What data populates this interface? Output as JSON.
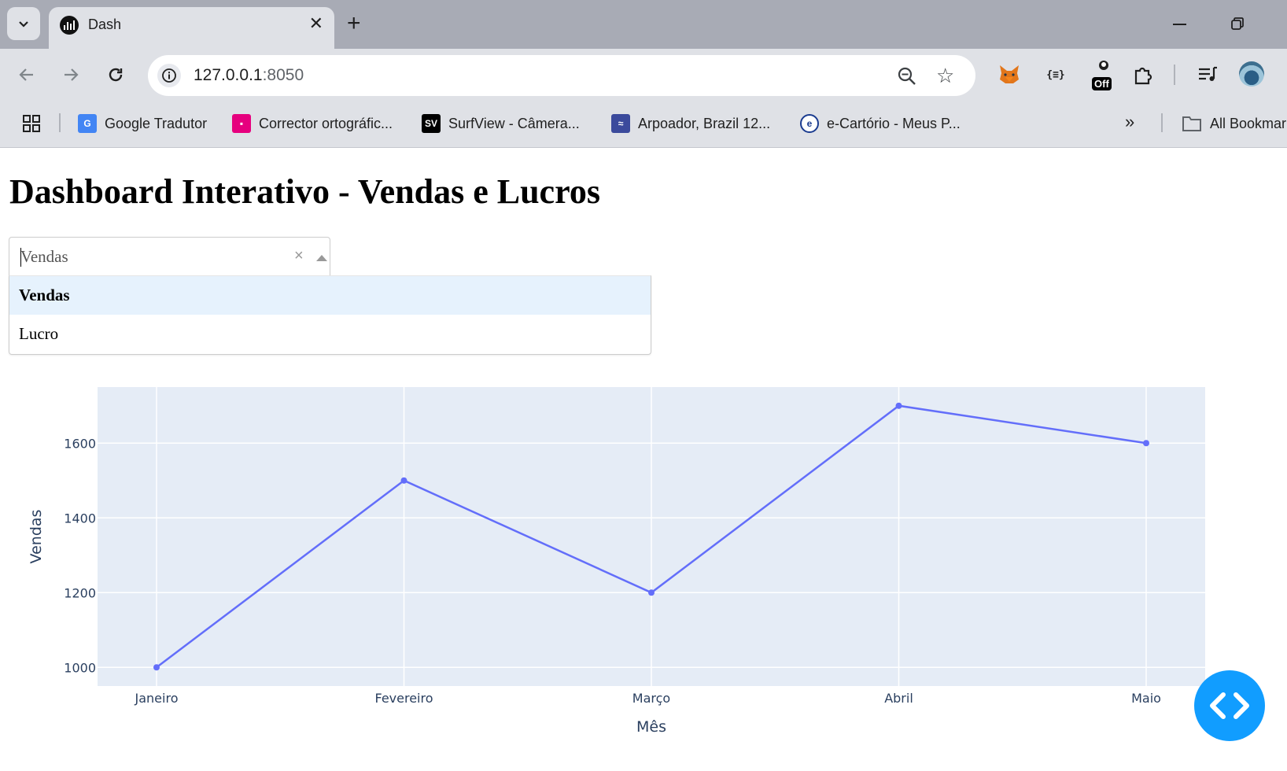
{
  "browser": {
    "tab_title": "Dash",
    "url_host": "127.0.0.1",
    "url_port": ":8050",
    "extensions": [
      "metamask-fox",
      "{≡}",
      "Off",
      "puzzle-piece"
    ],
    "bookmarks": [
      {
        "label": "Google Tradutor",
        "icon": "google-translate-icon"
      },
      {
        "label": "Corrector ortográfic...",
        "icon": "corrector-icon"
      },
      {
        "label": "SurfView - Câmera...",
        "icon": "surfview-icon"
      },
      {
        "label": "Arpoador, Brazil 12...",
        "icon": "arpoador-icon"
      },
      {
        "label": "e-Cartório - Meus P...",
        "icon": "ecartorio-icon"
      }
    ],
    "all_bookmarks": "All Bookmarks"
  },
  "page": {
    "title": "Dashboard Interativo - Vendas e Lucros"
  },
  "dropdown": {
    "value": "Vendas",
    "clear_symbol": "×",
    "options": [
      "Vendas",
      "Lucro"
    ],
    "highlighted_option": "Vendas"
  },
  "chart_data": {
    "type": "line",
    "categories": [
      "Janeiro",
      "Fevereiro",
      "Março",
      "Abril",
      "Maio"
    ],
    "series": [
      {
        "values": [
          1000,
          1500,
          1200,
          1700,
          1600
        ],
        "color": "#636efa"
      }
    ],
    "xlabel": "Mês",
    "ylabel": "Vendas",
    "yticks": [
      1000,
      1200,
      1400,
      1600
    ],
    "ylim": [
      950,
      1750
    ],
    "grid": true,
    "plot_bg": "#e5ecf6"
  },
  "colors": {
    "accent": "#119dff",
    "series": "#636efa",
    "chrome": "#dfe1e6"
  }
}
